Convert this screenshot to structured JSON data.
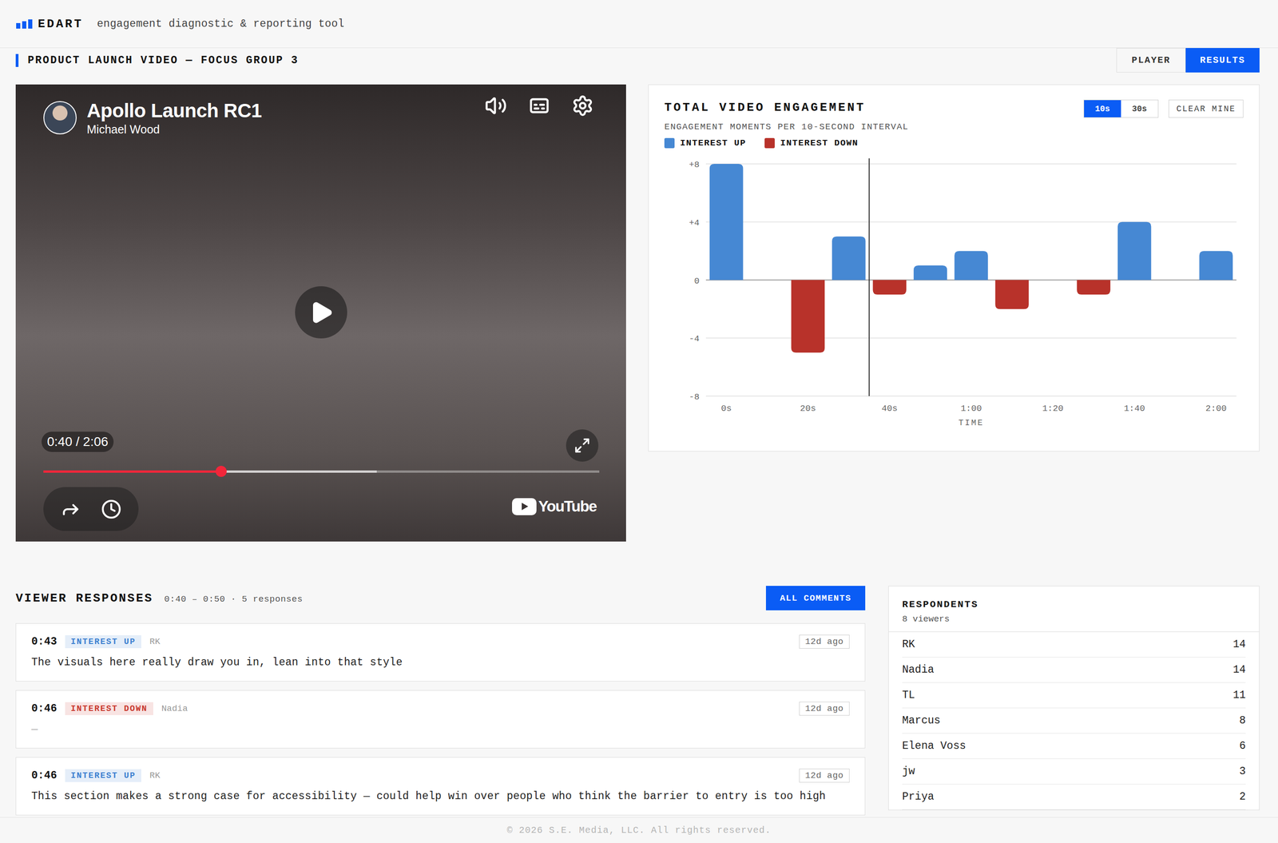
{
  "app": {
    "logo": "EDART",
    "tagline": "engagement diagnostic & reporting tool"
  },
  "page": {
    "title": "PRODUCT LAUNCH VIDEO — FOCUS GROUP 3"
  },
  "tabs": [
    {
      "label": "PLAYER",
      "selected": false
    },
    {
      "label": "RESULTS",
      "selected": true
    }
  ],
  "player": {
    "title": "Apollo Launch RC1",
    "channel": "Michael Wood",
    "time": "0:40 / 2:06",
    "progress": 0.32,
    "buffered": 0.6,
    "brand": "YouTube",
    "playing": false
  },
  "chart": {
    "title": "TOTAL VIDEO ENGAGEMENT",
    "subtitle": "ENGAGEMENT MOMENTS PER 10-SECOND INTERVAL",
    "interval_options": [
      {
        "label": "10s",
        "selected": true
      },
      {
        "label": "30s",
        "selected": false
      }
    ],
    "clear_button": "CLEAR MINE",
    "series": [
      {
        "name": "INTEREST UP",
        "color": "#4688d3",
        "values": [
          8,
          0,
          0,
          3,
          0,
          1,
          2,
          0,
          0,
          0,
          4,
          0,
          2
        ]
      },
      {
        "name": "INTEREST DOWN",
        "color": "#b8322a",
        "values": [
          0,
          0,
          -5,
          0,
          -1,
          0,
          0,
          -2,
          0,
          -1,
          0,
          0,
          0
        ]
      }
    ],
    "y_ticks": [
      "+8",
      "+4",
      "0",
      "-4",
      "-8"
    ],
    "x_ticks": [
      "0s",
      "20s",
      "40s",
      "1:00",
      "1:20",
      "1:40",
      "2:00"
    ],
    "x_axis_title": "TIME",
    "cursor_bin": 4
  },
  "responses": {
    "title": "VIEWER RESPONSES",
    "range": "0:40 – 0:50 · 5 responses",
    "button": "ALL COMMENTS",
    "items": [
      {
        "time": "0:43",
        "tag": "INTEREST UP",
        "color": "#3b7fd0",
        "author": "RK",
        "age": "12d ago",
        "text": "The visuals here really draw you in, lean into that style",
        "empty": false
      },
      {
        "time": "0:46",
        "tag": "INTEREST DOWN",
        "color": "#c8372d",
        "author": "Nadia",
        "age": "12d ago",
        "text": "—",
        "empty": true
      },
      {
        "time": "0:46",
        "tag": "INTEREST UP",
        "color": "#3b7fd0",
        "author": "RK",
        "age": "12d ago",
        "text": "This section makes a strong case for accessibility — could help win over people who think the barrier to entry is too high",
        "empty": false
      }
    ]
  },
  "respondents": {
    "title": "RESPONDENTS",
    "count": "8 viewers",
    "items": [
      {
        "name": "RK",
        "count": "14"
      },
      {
        "name": "Nadia",
        "count": "14"
      },
      {
        "name": "TL",
        "count": "11"
      },
      {
        "name": "Marcus",
        "count": "8"
      },
      {
        "name": "Elena Voss",
        "count": "6"
      },
      {
        "name": "jw",
        "count": "3"
      },
      {
        "name": "Priya",
        "count": "2"
      }
    ]
  },
  "footer": "© 2026 S.E. Media, LLC. All rights reserved."
}
